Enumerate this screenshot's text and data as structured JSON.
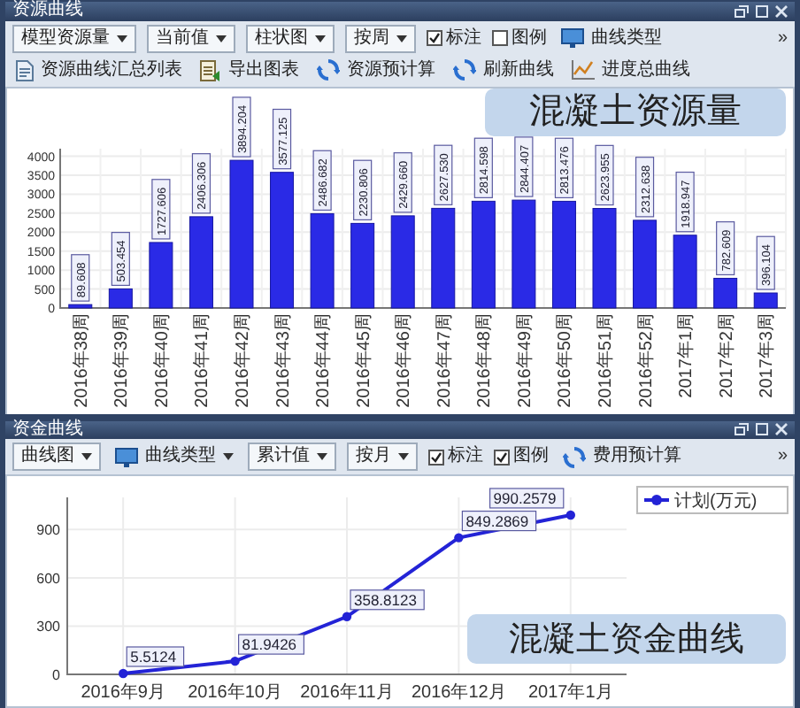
{
  "top_panel": {
    "title": "资源曲线",
    "toolbar": [
      {
        "kind": "dropdown",
        "label": "模型资源量"
      },
      {
        "kind": "dropdown",
        "label": "当前值"
      },
      {
        "kind": "dropdown",
        "label": "柱状图"
      },
      {
        "kind": "dropdown",
        "label": "按周"
      },
      {
        "kind": "checkbox",
        "label": "标注",
        "checked": true
      },
      {
        "kind": "checkbox",
        "label": "图例",
        "checked": false
      },
      {
        "kind": "button",
        "label": "曲线类型"
      },
      {
        "kind": "button",
        "label": "资源曲线汇总列表"
      },
      {
        "kind": "button",
        "label": "导出图表"
      },
      {
        "kind": "button",
        "label": "资源预计算"
      },
      {
        "kind": "button",
        "label": "刷新曲线"
      },
      {
        "kind": "button",
        "label": "进度总曲线"
      }
    ],
    "overflow": "»",
    "chart_data": {
      "type": "bar",
      "categories": [
        "2016年38周",
        "2016年39周",
        "2016年40周",
        "2016年41周",
        "2016年42周",
        "2016年43周",
        "2016年44周",
        "2016年45周",
        "2016年46周",
        "2016年47周",
        "2016年48周",
        "2016年49周",
        "2016年50周",
        "2016年51周",
        "2016年52周",
        "2017年1周",
        "2017年2周",
        "2017年3周"
      ],
      "values": [
        89.608,
        503.454,
        1727.606,
        2406.306,
        3894.204,
        3577.125,
        2486.682,
        2230.806,
        2429.66,
        2627.53,
        2814.598,
        2844.407,
        2813.476,
        2623.955,
        2312.638,
        1918.947,
        782.609,
        396.104
      ],
      "value_labels": [
        "89.608",
        "503.454",
        "1727.606",
        "2406.306",
        "3894.204",
        "3577.125",
        "2486.682",
        "2230.806",
        "2429.660",
        "2627.530",
        "2814.598",
        "2844.407",
        "2813.476",
        "2623.955",
        "2312.638",
        "1918.947",
        "782.609",
        "396.104"
      ],
      "ylim": [
        0,
        4200
      ],
      "grid": true,
      "yticks": [
        0,
        500,
        1000,
        1500,
        2000,
        2500,
        3000,
        3500,
        4000
      ]
    },
    "callout": "混凝土资源量"
  },
  "bottom_panel": {
    "title": "资金曲线",
    "toolbar": [
      {
        "kind": "dropdown",
        "label": "曲线图"
      },
      {
        "kind": "split_button",
        "label": "曲线类型"
      },
      {
        "kind": "dropdown",
        "label": "累计值"
      },
      {
        "kind": "dropdown",
        "label": "按月"
      },
      {
        "kind": "checkbox",
        "label": "标注",
        "checked": true
      },
      {
        "kind": "checkbox",
        "label": "图例",
        "checked": true
      },
      {
        "kind": "button",
        "label": "费用预计算"
      }
    ],
    "overflow": "»",
    "chart_data": {
      "type": "line",
      "categories": [
        "2016年9月",
        "2016年10月",
        "2016年11月",
        "2016年12月",
        "2017年1月"
      ],
      "series": [
        {
          "name": "计划(万元)",
          "color": "#2323d6",
          "marker": "circle",
          "values": [
            5.5124,
            81.9426,
            358.8123,
            849.2869,
            990.2579
          ]
        }
      ],
      "grid": true,
      "value_labels": [
        "5.5124",
        "81.9426",
        "358.8123",
        "849.2869",
        "990.2579"
      ],
      "ylim": [
        0,
        1100
      ],
      "yticks": [
        0,
        300,
        600,
        900
      ]
    },
    "callout": "混凝土资金曲线"
  }
}
